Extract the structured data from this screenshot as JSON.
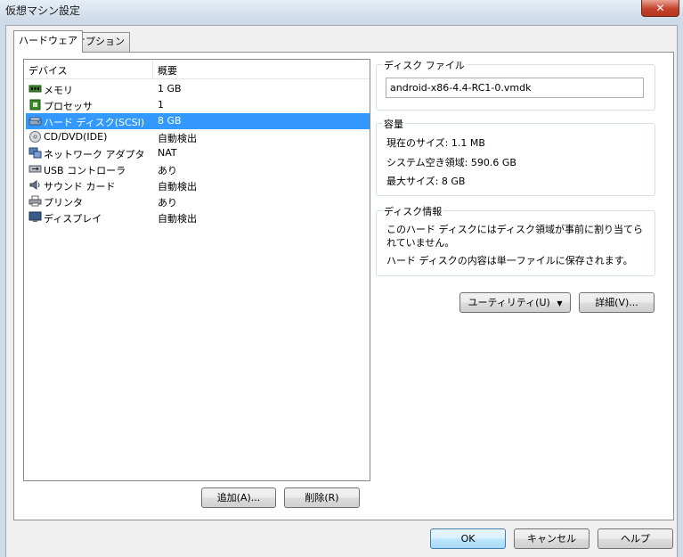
{
  "window": {
    "title": "仮想マシン設定",
    "close_label": "✕"
  },
  "tabs": [
    {
      "label": "ハードウェア"
    },
    {
      "label": "オプション"
    }
  ],
  "device_list": {
    "columns": [
      "デバイス",
      "概要"
    ],
    "rows": [
      {
        "name": "メモリ",
        "summary": "1 GB",
        "icon": "memory-icon"
      },
      {
        "name": "プロセッサ",
        "summary": "1",
        "icon": "processor-icon"
      },
      {
        "name": "ハード ディスク(SCSI)",
        "summary": "8 GB",
        "icon": "hard-disk-icon",
        "selected": true
      },
      {
        "name": "CD/DVD(IDE)",
        "summary": "自動検出",
        "icon": "cd-dvd-icon"
      },
      {
        "name": "ネットワーク アダプタ",
        "summary": "NAT",
        "icon": "network-adapter-icon"
      },
      {
        "name": "USB コントローラ",
        "summary": "あり",
        "icon": "usb-controller-icon"
      },
      {
        "name": "サウンド カード",
        "summary": "自動検出",
        "icon": "sound-card-icon"
      },
      {
        "name": "プリンタ",
        "summary": "あり",
        "icon": "printer-icon"
      },
      {
        "name": "ディスプレイ",
        "summary": "自動検出",
        "icon": "display-icon"
      }
    ]
  },
  "list_buttons": {
    "add": "追加(A)...",
    "remove": "削除(R)"
  },
  "disk_file": {
    "title": "ディスク ファイル",
    "value": "android-x86-4.4-RC1-0.vmdk"
  },
  "capacity": {
    "title": "容量",
    "current_size_label": "現在のサイズ:",
    "current_size": "1.1 MB",
    "free_space_label": "システム空き領域:",
    "free_space": "590.6 GB",
    "max_size_label": "最大サイズ:",
    "max_size": "8 GB"
  },
  "disk_info": {
    "title": "ディスク情報",
    "line1": "このハード ディスクにはディスク領域が事前に割り当てられていません。",
    "line2": "ハード ディスクの内容は単一ファイルに保存されます。"
  },
  "disk_buttons": {
    "utility": "ユーティリティ(U)",
    "advanced": "詳細(V)..."
  },
  "dialog_buttons": {
    "ok": "OK",
    "cancel": "キャンセル",
    "help": "ヘルプ"
  },
  "colors": {
    "selection": "#3399ff",
    "window_frame": "#cfdbe8"
  }
}
